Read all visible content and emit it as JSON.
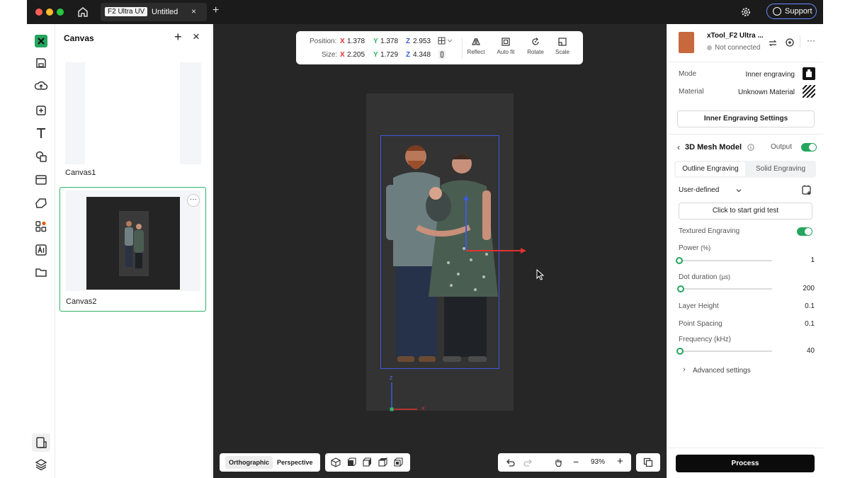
{
  "titlebar": {
    "tab_badge": "F2 Ultra UV",
    "tab_title": "Untitled",
    "close_glyph": "×",
    "newtab_glyph": "+",
    "support_label": "Support"
  },
  "panel": {
    "title": "Canvas",
    "add_glyph": "+",
    "close_glyph": "×",
    "canvases": [
      {
        "label": "Canvas1"
      },
      {
        "label": "Canvas2"
      }
    ],
    "more_glyph": "···"
  },
  "transform": {
    "position_label": "Position:",
    "size_label": "Size:",
    "position": {
      "x": "1.378",
      "y": "1.378",
      "z": "2.953"
    },
    "size": {
      "x": "2.205",
      "y": "1.729",
      "z": "4.348"
    },
    "axis": {
      "x": "X",
      "y": "Y",
      "z": "Z"
    },
    "tools": [
      "Reflect",
      "Auto fit",
      "Rotate",
      "Scale"
    ]
  },
  "viewbar": {
    "orthographic": "Orthographic",
    "perspective": "Perspective",
    "zoom": "93%",
    "minus": "−",
    "plus": "+"
  },
  "axis_gizmo": {
    "z": "Z",
    "x": "X"
  },
  "right": {
    "device_name": "xTool_F2 Ultra ...",
    "device_status": "Not connected",
    "mode_label": "Mode",
    "mode_value": "Inner engraving",
    "material_label": "Material",
    "material_value": "Unknown Material",
    "settings_button": "Inner Engraving Settings",
    "section_title": "3D Mesh Model",
    "output_label": "Output",
    "tab_outline": "Outline Engraving",
    "tab_solid": "Solid Engraving",
    "preset": "User-defined",
    "grid_test": "Click to start grid test",
    "textured_label": "Textured Engraving",
    "power_label": "Power",
    "power_unit": "(%)",
    "power_value": "1",
    "dot_label": "Dot duration",
    "dot_unit": "(µs)",
    "dot_value": "200",
    "layer_label": "Layer Height",
    "layer_value": "0.1",
    "spacing_label": "Point Spacing",
    "spacing_value": "0.1",
    "freq_label": "Frequency",
    "freq_unit": "(kHz)",
    "freq_value": "40",
    "advanced": "Advanced settings",
    "process": "Process"
  },
  "colors": {
    "accent_green": "#25a55f",
    "selection_blue": "#3b5bdb",
    "axis_x": "#e03131",
    "axis_y": "#2fb36a",
    "axis_z": "#3b5bdb",
    "titlebar": "#1b1b1b",
    "viewport": "#262626"
  }
}
